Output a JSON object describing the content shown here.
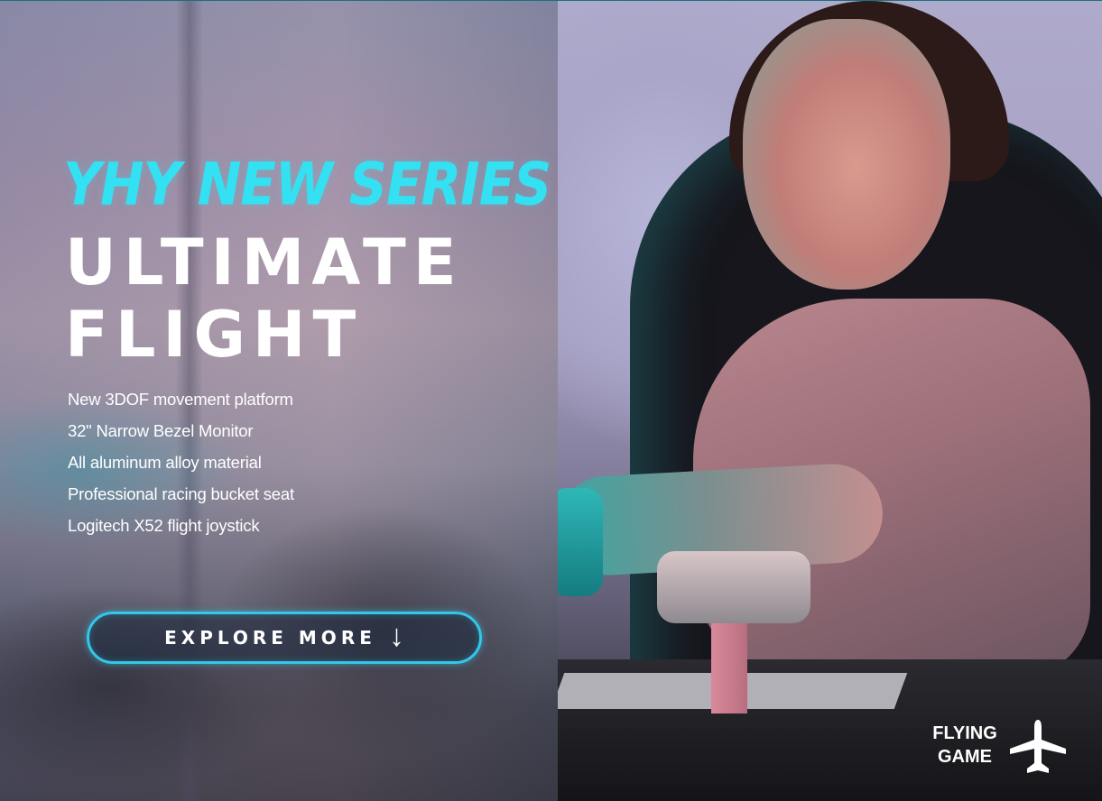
{
  "hero": {
    "series_title": "YHY NEW SERIES",
    "main_title_line1": "ULTIMATE",
    "main_title_line2": "FLIGHT",
    "features": [
      "New 3DOF movement platform",
      "32\" Narrow Bezel Monitor",
      "All aluminum alloy material",
      "Professional racing bucket seat",
      "Logitech X52 flight joystick"
    ],
    "cta_label": "EXPLORE MORE",
    "cta_icon": "arrow-down-icon"
  },
  "badge": {
    "line1": "FLYING",
    "line2": "GAME",
    "icon": "airplane-icon"
  },
  "colors": {
    "accent": "#33e1f2",
    "button_border": "#33c7e8",
    "text": "#ffffff"
  }
}
